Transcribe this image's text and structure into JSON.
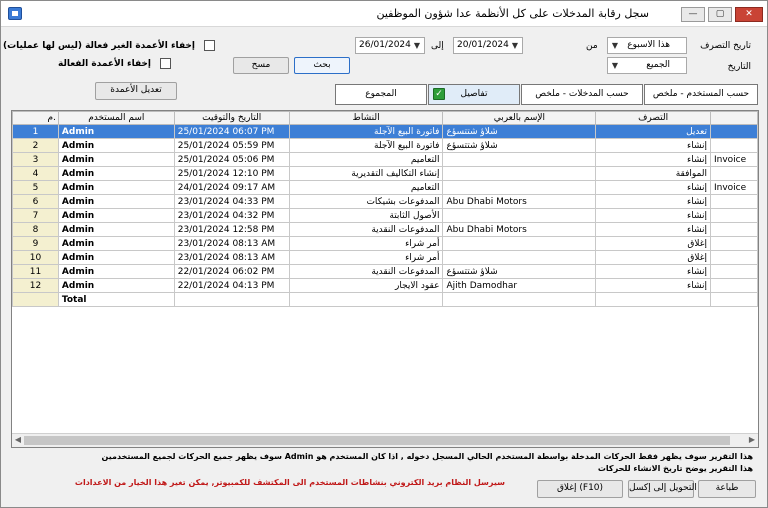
{
  "window": {
    "title": "سجل رقابة المدخلات على كل الأنظمة عدا شؤون الموظفين",
    "minimize": "—",
    "maximize": "▢",
    "close": "✕"
  },
  "filters": {
    "date_mode_label": "تاريخ التصرف",
    "from_label": "من",
    "to_label": "إلى",
    "period_value": "هذا الاسبوع",
    "from_date": "26/01/2024",
    "to_date": "20/01/2024",
    "history_label": "التاريخ",
    "history_value": "الجميع",
    "hide_inactive_label": "إخفاء الأعمدة الغير فعالة (ليس لها عمليات)",
    "hide_active_label": "إخفاء الأعمدة الفعالة",
    "search_button": "بحث",
    "clear_button": "مسح",
    "edit_columns_button": "تعديل الأعمدة"
  },
  "tabs": [
    {
      "label": "حسب المستخدم - ملخص",
      "active": false
    },
    {
      "label": "حسب المدخلات - ملخص",
      "active": false
    },
    {
      "label": "تفاصيل",
      "active": true
    },
    {
      "label": "المجموع",
      "active": false
    }
  ],
  "table": {
    "headers": {
      "rownum": "م.",
      "user": "اسم المستخدم",
      "datetime": "التاريخ والتوقيت",
      "activity": "النشاط",
      "arabic_name": "الإسم بالعربي",
      "action": "التصرف",
      "extra": ""
    },
    "rows": [
      {
        "n": "1",
        "user": "Admin",
        "dt": "25/01/2024 06:07 PM",
        "activity": "فاتورة البيع الآجلة",
        "name": "شلاؤ شتتسؤع",
        "action": "تعديل",
        "extra": ""
      },
      {
        "n": "2",
        "user": "Admin",
        "dt": "25/01/2024 05:59 PM",
        "activity": "فاتورة البيع الآجلة",
        "name": "شلاؤ شتتسؤع",
        "action": "إنشاء",
        "extra": ""
      },
      {
        "n": "3",
        "user": "Admin",
        "dt": "25/01/2024 05:06 PM",
        "activity": "التعاميم",
        "name": "",
        "action": "إنشاء",
        "extra": "Invoice"
      },
      {
        "n": "4",
        "user": "Admin",
        "dt": "25/01/2024 12:10 PM",
        "activity": "إنشاء التكاليف التقديرية",
        "name": "",
        "action": "الموافقة",
        "extra": ""
      },
      {
        "n": "5",
        "user": "Admin",
        "dt": "24/01/2024 09:17 AM",
        "activity": "التعاميم",
        "name": "",
        "action": "إنشاء",
        "extra": "Invoice"
      },
      {
        "n": "6",
        "user": "Admin",
        "dt": "23/01/2024 04:33 PM",
        "activity": "المدفوعات بشيكات",
        "name": "Abu Dhabi Motors",
        "action": "إنشاء",
        "extra": ""
      },
      {
        "n": "7",
        "user": "Admin",
        "dt": "23/01/2024 04:32 PM",
        "activity": "الأصول الثابتة",
        "name": "",
        "action": "إنشاء",
        "extra": ""
      },
      {
        "n": "8",
        "user": "Admin",
        "dt": "23/01/2024 12:58 PM",
        "activity": "المدفوعات النقدية",
        "name": "Abu Dhabi Motors",
        "action": "إنشاء",
        "extra": ""
      },
      {
        "n": "9",
        "user": "Admin",
        "dt": "23/01/2024 08:13 AM",
        "activity": "أمر شراء",
        "name": "",
        "action": "إغلاق",
        "extra": ""
      },
      {
        "n": "10",
        "user": "Admin",
        "dt": "23/01/2024 08:13 AM",
        "activity": "أمر شراء",
        "name": "",
        "action": "إغلاق",
        "extra": ""
      },
      {
        "n": "11",
        "user": "Admin",
        "dt": "22/01/2024 06:02 PM",
        "activity": "المدفوعات النقدية",
        "name": "شلاؤ شتتسؤع",
        "action": "إنشاء",
        "extra": ""
      },
      {
        "n": "12",
        "user": "Admin",
        "dt": "22/01/2024 04:13 PM",
        "activity": "عقود الايجار",
        "name": "Ajith Damodhar",
        "action": "إنشاء",
        "extra": ""
      }
    ],
    "total_label": "Total"
  },
  "notes": {
    "line1": "هذا التقرير سوف يظهر فقط الحركات المدخلة بواسطة المستخدم الحالي المسجل دخوله , اذا كان المستخدم هو Admin سوف يظهر جميع الحركات لجميع المستخدمين",
    "line2": "هذا التقرير يوضح تاريخ الانشاء للحركات",
    "line3": "سيرسل النظام بريد الكتروني بنشاطات المستخدم الى المكتشف للكمبيوتر, يمكن تغير هذا الخيار من الاعدادات"
  },
  "buttons": {
    "print": "طباعة",
    "export_excel": "التحويل إلى إكسل",
    "close": "إغلاق (F10)"
  }
}
